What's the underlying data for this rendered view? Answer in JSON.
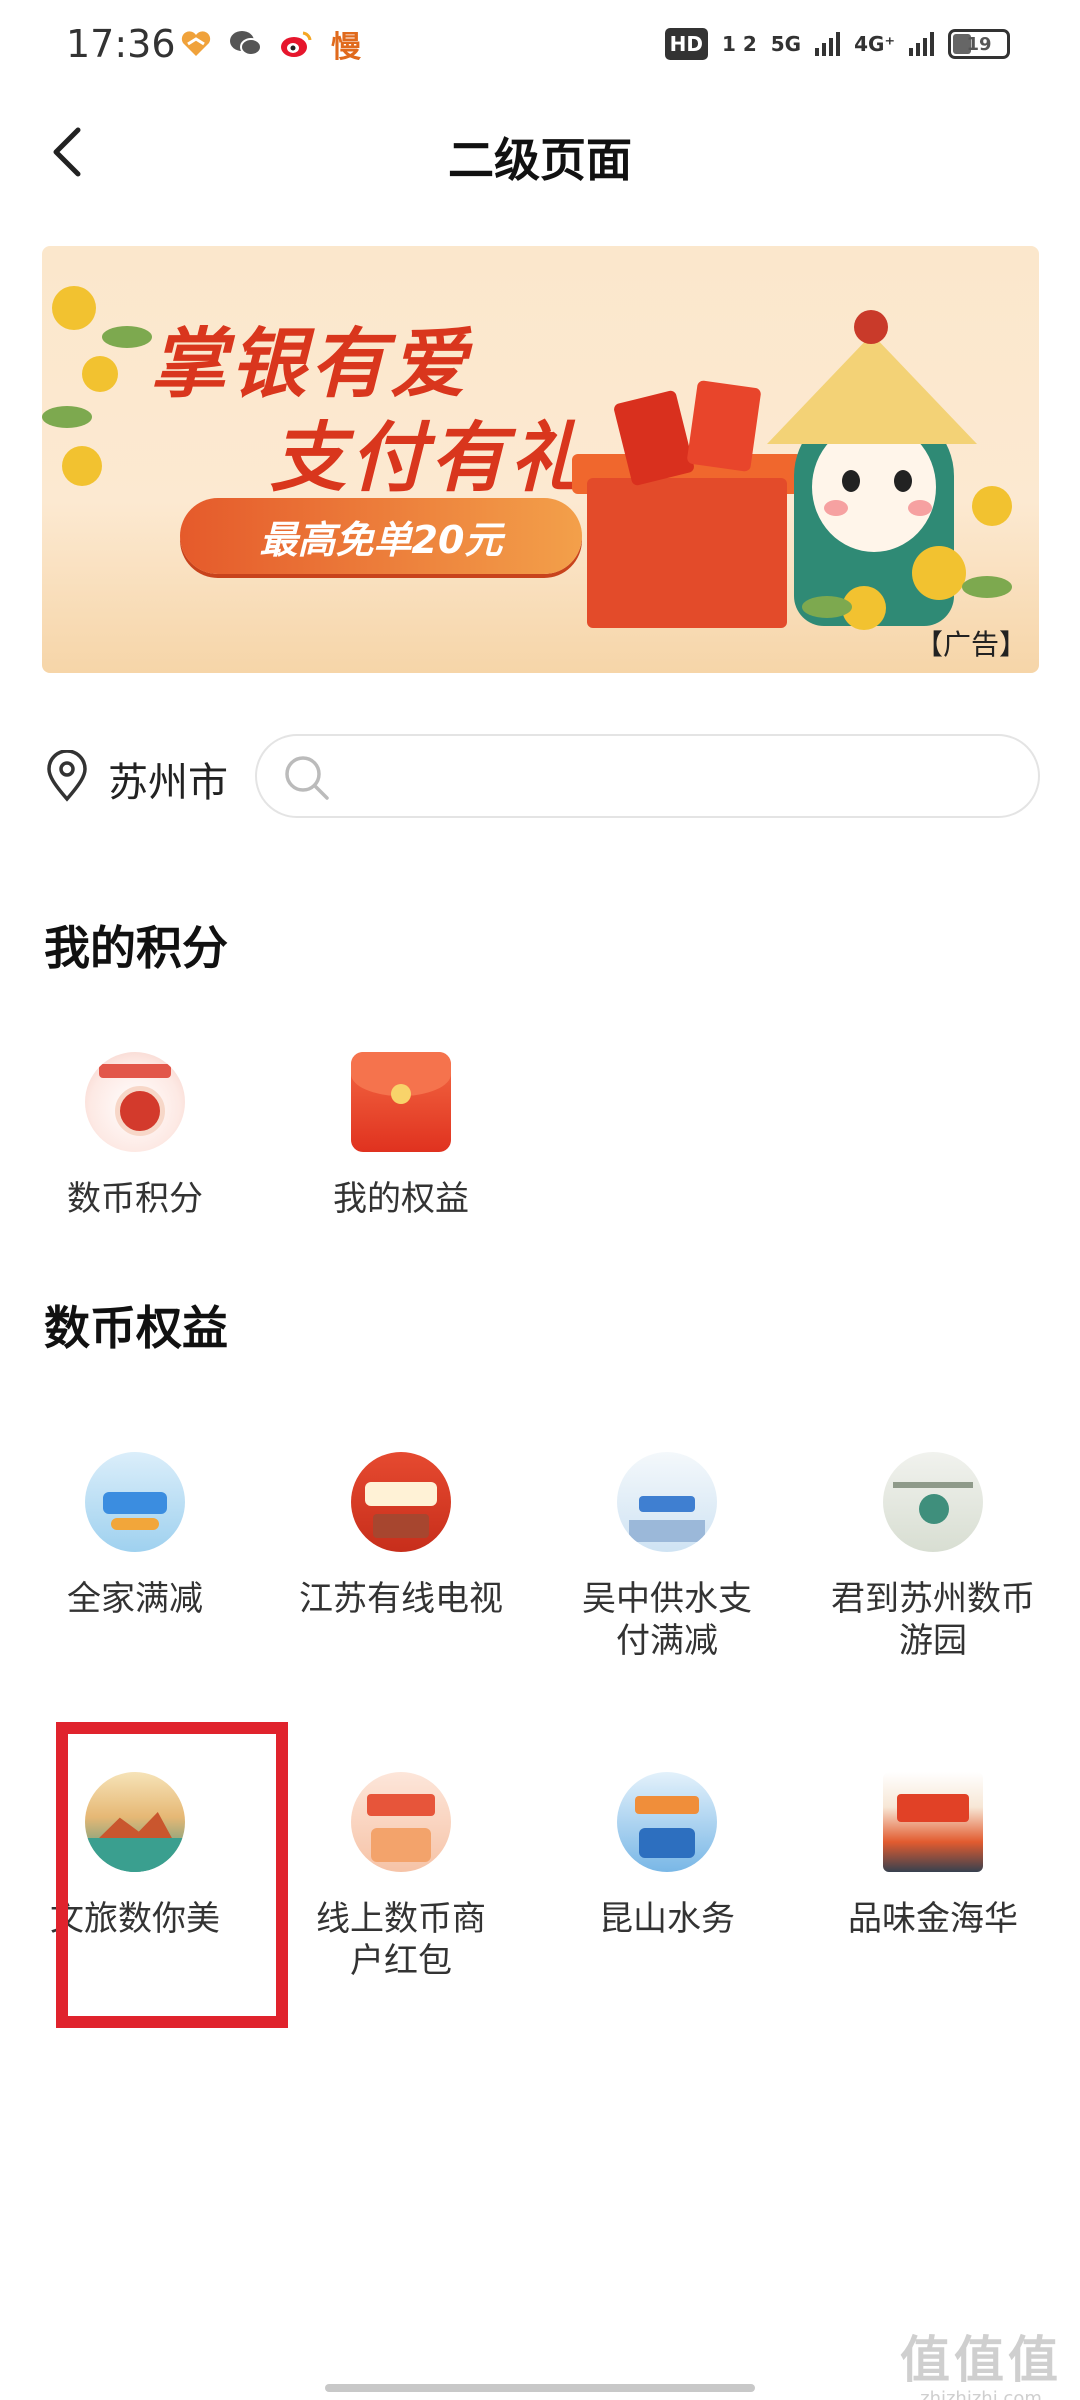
{
  "status_bar": {
    "time": "17:36",
    "left_icons": [
      "heart-app-icon",
      "wechat-icon",
      "weibo-icon"
    ],
    "left_text_icon": "慢",
    "signal1": "HD",
    "signal1_sub": "1 2",
    "signal2": "5G",
    "signal3": "4G⁺",
    "battery": "19"
  },
  "nav": {
    "title": "二级页面"
  },
  "banner": {
    "title_line1": "掌银有爱",
    "title_line2": "支付有礼",
    "pill_text": "最高免单20元",
    "ad_tag": "【广告】",
    "colors": {
      "title": "#d9361d",
      "background": "#fbe7cc"
    }
  },
  "location": {
    "city": "苏州市",
    "search_placeholder": ""
  },
  "sections": {
    "points_title": "我的积分",
    "benefits_title": "数币权益"
  },
  "points_items": [
    {
      "label": "数币积分",
      "icon": "digital-rmb-points-icon"
    },
    {
      "label": "我的权益",
      "icon": "red-envelope-icon"
    }
  ],
  "benefit_items": [
    {
      "label": "全家满减",
      "icon": "familymart-discount-icon"
    },
    {
      "label": "江苏有线电视",
      "icon": "jiangsu-cable-tv-icon"
    },
    {
      "label": "吴中供水支付满减",
      "icon": "wuzhong-water-icon"
    },
    {
      "label": "君到苏州数币游园",
      "icon": "suzhou-park-icon"
    },
    {
      "label": "文旅数你美",
      "icon": "culture-tourism-icon"
    },
    {
      "label": "线上数币商户红包",
      "icon": "online-merchant-redpacket-icon"
    },
    {
      "label": "昆山水务",
      "icon": "kunshan-water-icon"
    },
    {
      "label": "品味金海华",
      "icon": "jinhaihua-food-icon"
    }
  ],
  "highlight_color": "#e0232d",
  "watermark": {
    "main": "值值值",
    "sub": "zhizhizhi.com"
  }
}
